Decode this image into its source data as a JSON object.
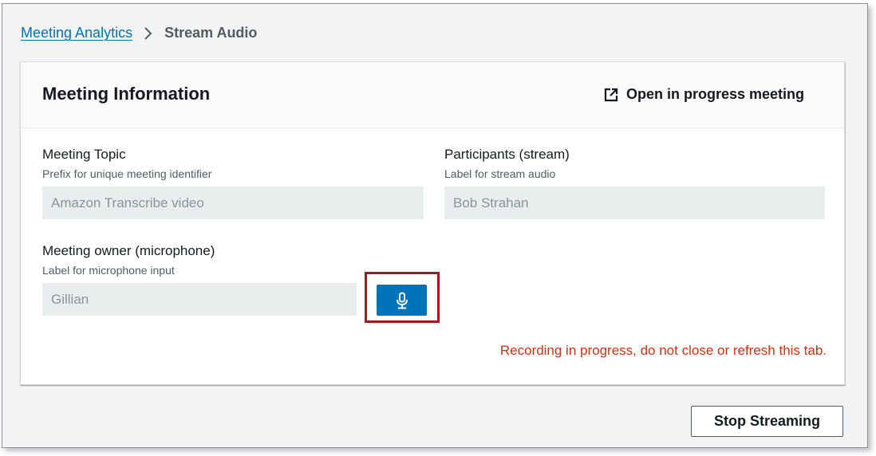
{
  "breadcrumb": {
    "parent": "Meeting Analytics",
    "current": "Stream Audio"
  },
  "panel": {
    "title": "Meeting Information",
    "open_link": "Open in progress meeting"
  },
  "fields": {
    "topic": {
      "label": "Meeting Topic",
      "description": "Prefix for unique meeting identifier",
      "value": "Amazon Transcribe video"
    },
    "participants": {
      "label": "Participants (stream)",
      "description": "Label for stream audio",
      "value": "Bob Strahan"
    },
    "owner": {
      "label": "Meeting owner (microphone)",
      "description": "Label for microphone input",
      "value": "Gillian"
    }
  },
  "recording_message": "Recording in progress, do not close or refresh this tab.",
  "stop_button": "Stop Streaming",
  "icons": {
    "breadcrumb_separator": "chevron-right-icon",
    "open_link": "external-link-icon",
    "mic": "microphone-icon"
  },
  "colors": {
    "link": "#0073bb",
    "primary_button": "#0073bb",
    "error_text": "#d13212",
    "highlight_box": "#a3191d"
  }
}
